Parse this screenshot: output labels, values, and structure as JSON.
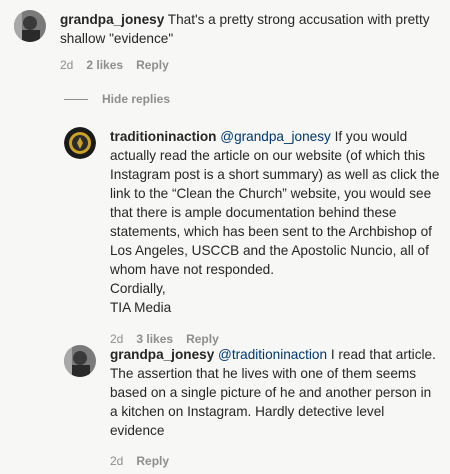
{
  "comments": [
    {
      "username": "grandpa_jonesy",
      "lines": [
        "That's a pretty strong accusation with pretty",
        "shallow \"evidence\""
      ],
      "time": "2d",
      "likes": "2 likes",
      "reply": "Reply"
    }
  ],
  "hide_replies": "Hide replies",
  "replies": [
    {
      "username": "traditioninaction",
      "mention": "@grandpa_jonesy",
      "first_line_rest": " If you would",
      "lines": [
        "actually read the article on our website (of which this",
        "Instagram post is a short summary) as well as click the",
        "link to the “Clean the Church” website, you would see",
        "that there is ample documentation behind these",
        "statements, which has been sent to the Archbishop of",
        "Los Angeles, USCCB and the Apostolic Nuncio, all of",
        "whom have not responded.",
        "Cordially,",
        "TIA Media"
      ],
      "time": "2d",
      "likes": "3 likes",
      "reply": "Reply"
    },
    {
      "username": "grandpa_jonesy",
      "mention": "@traditioninaction",
      "first_line_rest": " I read that article.",
      "lines": [
        "The assertion that he lives with one of them seems",
        "based on a single picture of he and another person in",
        "a kitchen on Instagram. Hardly detective level",
        "evidence"
      ],
      "time": "2d",
      "reply": "Reply"
    }
  ]
}
